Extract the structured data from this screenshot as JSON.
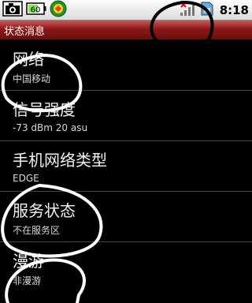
{
  "statusbar": {
    "time": "8:18",
    "icons": [
      "screenshot-icon",
      "battery-60-icon",
      "app-icon",
      "signal-no-service-icon",
      "sim-icon"
    ],
    "battery_text": "60"
  },
  "titlebar": {
    "title": "状态消息"
  },
  "items": [
    {
      "title": "网络",
      "subtitle": "中国移动"
    },
    {
      "title": "信号强度",
      "subtitle": "-73 dBm   20 asu"
    },
    {
      "title": "手机网络类型",
      "subtitle": "EDGE"
    },
    {
      "title": "服务状态",
      "subtitle": "不在服务区"
    },
    {
      "title": "漫游",
      "subtitle": "非漫游"
    }
  ]
}
